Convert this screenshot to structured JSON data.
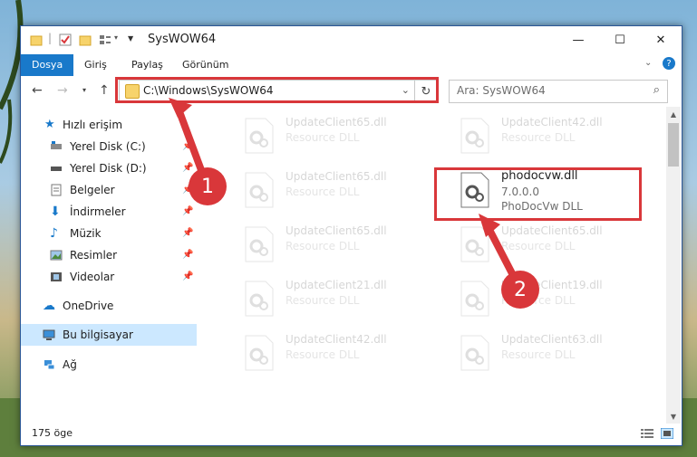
{
  "window": {
    "title": "SysWOW64"
  },
  "ribbon": {
    "tabs": [
      "Dosya",
      "Giriş",
      "Paylaş",
      "Görünüm"
    ]
  },
  "address": {
    "path": "C:\\Windows\\SysWOW64"
  },
  "search": {
    "placeholder": "Ara: SysWOW64"
  },
  "sidebar": {
    "items": [
      {
        "label": "Hızlı erişim"
      },
      {
        "label": "Yerel Disk (C:)"
      },
      {
        "label": "Yerel Disk (D:)"
      },
      {
        "label": "Belgeler"
      },
      {
        "label": "İndirmeler"
      },
      {
        "label": "Müzik"
      },
      {
        "label": "Resimler"
      },
      {
        "label": "Videolar"
      },
      {
        "label": "OneDrive"
      },
      {
        "label": "Bu bilgisayar"
      },
      {
        "label": "Ağ"
      }
    ]
  },
  "files": [
    {
      "name": "UpdateClient65.dll",
      "desc": "Resource DLL"
    },
    {
      "name": "UpdateClient42.dll",
      "desc": "Resource DLL"
    },
    {
      "name": "UpdateClient65.dll",
      "desc": "Resource DLL"
    },
    {
      "name": "phodocvw.dll",
      "version": "7.0.0.0",
      "desc": "PhoDocVw DLL"
    },
    {
      "name": "UpdateClient65.dll",
      "desc": "Resource DLL"
    },
    {
      "name": "UpdateClient65.dll",
      "desc": "Resource DLL"
    },
    {
      "name": "UpdateClient21.dll",
      "desc": "Resource DLL"
    },
    {
      "name": "UpdateClient19.dll",
      "desc": "Resource DLL"
    },
    {
      "name": "UpdateClient42.dll",
      "desc": "Resource DLL"
    },
    {
      "name": "UpdateClient63.dll",
      "desc": "Resource DLL"
    }
  ],
  "status": {
    "count": "175 öge"
  },
  "callouts": [
    "1",
    "2"
  ],
  "colors": {
    "accent": "#1979ca",
    "highlight": "#d9373a"
  }
}
